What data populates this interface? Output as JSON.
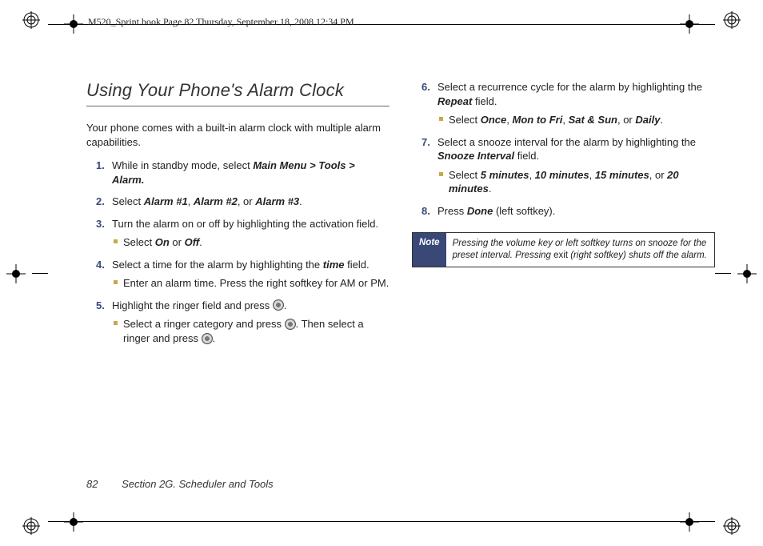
{
  "header": "M520_Sprint.book  Page 82  Thursday, September 18, 2008  12:34 PM",
  "title": "Using Your Phone's Alarm Clock",
  "intro": "Your phone comes with a built-in alarm clock with multiple alarm capabilities.",
  "colA": {
    "s1": {
      "num": "1.",
      "t1": "While in standby mode, select ",
      "b1": "Main Menu > Tools > Alarm."
    },
    "s2": {
      "num": "2.",
      "t1": "Select ",
      "b1": "Alarm #1",
      "t2": ", ",
      "b2": "Alarm #2",
      "t3": ", or ",
      "b3": "Alarm #3",
      "t4": "."
    },
    "s3": {
      "num": "3.",
      "t1": "Turn the alarm on or off by highlighting the activation field.",
      "sub_t1": "Select ",
      "sub_b1": "On",
      "sub_t2": " or ",
      "sub_b2": "Off",
      "sub_t3": "."
    },
    "s4": {
      "num": "4.",
      "t1": "Select a time for the alarm by highlighting the ",
      "b1": "time",
      "t2": " field.",
      "sub_t1": "Enter an alarm time. Press the right softkey for AM or PM."
    },
    "s5": {
      "num": "5.",
      "t1": "Highlight the ringer field and press ",
      "t2": ".",
      "sub_t1": "Select a ringer category and press ",
      "sub_t2": ". Then select a ringer and press ",
      "sub_t3": "."
    }
  },
  "colB": {
    "s6": {
      "num": "6.",
      "t1": "Select a recurrence cycle for the alarm by highlighting the ",
      "b1": "Repeat",
      "t2": " field.",
      "sub_t1": "Select ",
      "sub_b1": "Once",
      "sub_t2": ", ",
      "sub_b2": "Mon to Fri",
      "sub_t3": ", ",
      "sub_b3": "Sat & Sun",
      "sub_t4": ", or ",
      "sub_b4": "Daily",
      "sub_t5": "."
    },
    "s7": {
      "num": "7.",
      "t1": "Select a snooze interval for the alarm by highlighting the ",
      "b1": "Snooze Interval",
      "t2": " field.",
      "sub_t1": "Select ",
      "sub_b1": "5 minutes",
      "sub_t2": ", ",
      "sub_b2": "10 minutes",
      "sub_t3": ", ",
      "sub_b3": "15 minutes",
      "sub_t4": ", or ",
      "sub_b4": "20 minutes",
      "sub_t5": "."
    },
    "s8": {
      "num": "8.",
      "t1": "Press ",
      "b1": "Done",
      "t2": " (left softkey)."
    }
  },
  "note": {
    "label": "Note",
    "t1": "Pressing the volume key or left softkey turns on snooze for the preset interval. Pressing ",
    "u1": "exit",
    "t2": " (right softkey) shuts off the alarm."
  },
  "footer": {
    "page": "82",
    "section": "Section 2G. Scheduler and Tools"
  }
}
